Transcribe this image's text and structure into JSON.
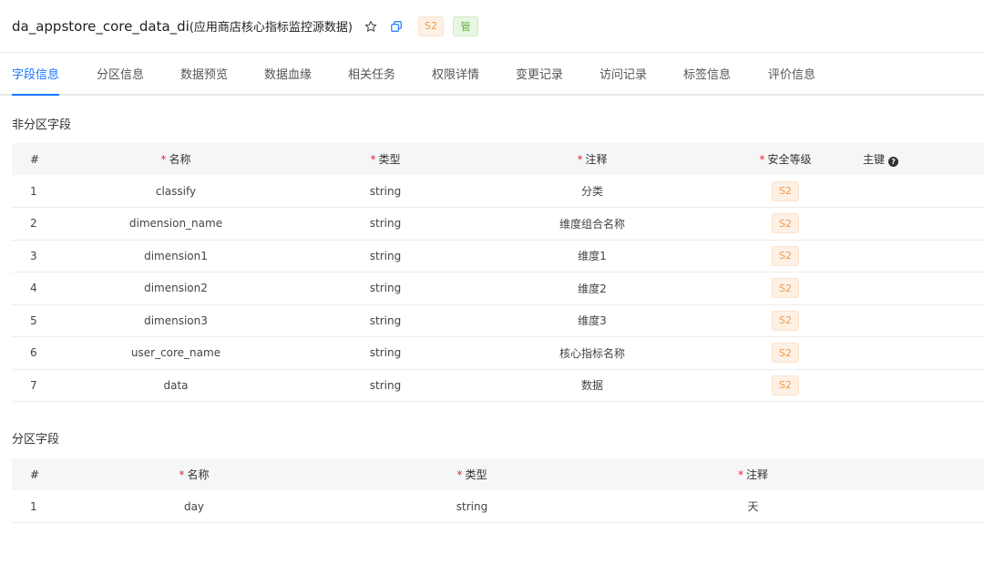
{
  "header": {
    "title": "da_appstore_core_data_di",
    "title_suffix": "(应用商店核心指标监控源数据)",
    "star_icon": "star-icon",
    "copy_icon": "copy-icon",
    "security_tag": "S2",
    "manage_tag": "管"
  },
  "tabs": [
    {
      "label": "字段信息",
      "active": true
    },
    {
      "label": "分区信息"
    },
    {
      "label": "数据预览"
    },
    {
      "label": "数据血缘"
    },
    {
      "label": "相关任务"
    },
    {
      "label": "权限详情"
    },
    {
      "label": "变更记录"
    },
    {
      "label": "访问记录"
    },
    {
      "label": "标签信息"
    },
    {
      "label": "评价信息"
    }
  ],
  "non_partition": {
    "title": "非分区字段",
    "columns": {
      "index": "#",
      "name": "名称",
      "type": "类型",
      "comment": "注释",
      "security": "安全等级",
      "primary_key": "主键"
    },
    "rows": [
      {
        "index": "1",
        "name": "classify",
        "type": "string",
        "comment": "分类",
        "security": "S2"
      },
      {
        "index": "2",
        "name": "dimension_name",
        "type": "string",
        "comment": "维度组合名称",
        "security": "S2"
      },
      {
        "index": "3",
        "name": "dimension1",
        "type": "string",
        "comment": "维度1",
        "security": "S2"
      },
      {
        "index": "4",
        "name": "dimension2",
        "type": "string",
        "comment": "维度2",
        "security": "S2"
      },
      {
        "index": "5",
        "name": "dimension3",
        "type": "string",
        "comment": "维度3",
        "security": "S2"
      },
      {
        "index": "6",
        "name": "user_core_name",
        "type": "string",
        "comment": "核心指标名称",
        "security": "S2"
      },
      {
        "index": "7",
        "name": "data",
        "type": "string",
        "comment": "数据",
        "security": "S2"
      }
    ]
  },
  "partition": {
    "title": "分区字段",
    "columns": {
      "index": "#",
      "name": "名称",
      "type": "类型",
      "comment": "注释"
    },
    "rows": [
      {
        "index": "1",
        "name": "day",
        "type": "string",
        "comment": "天"
      }
    ]
  },
  "colors": {
    "accent": "#1677ff",
    "security_tag_bg": "#fdf1e6",
    "security_tag_text": "#f2994a",
    "manage_tag_bg": "#e7f6e2",
    "manage_tag_text": "#58b13a",
    "required_star": "#f5222d"
  }
}
